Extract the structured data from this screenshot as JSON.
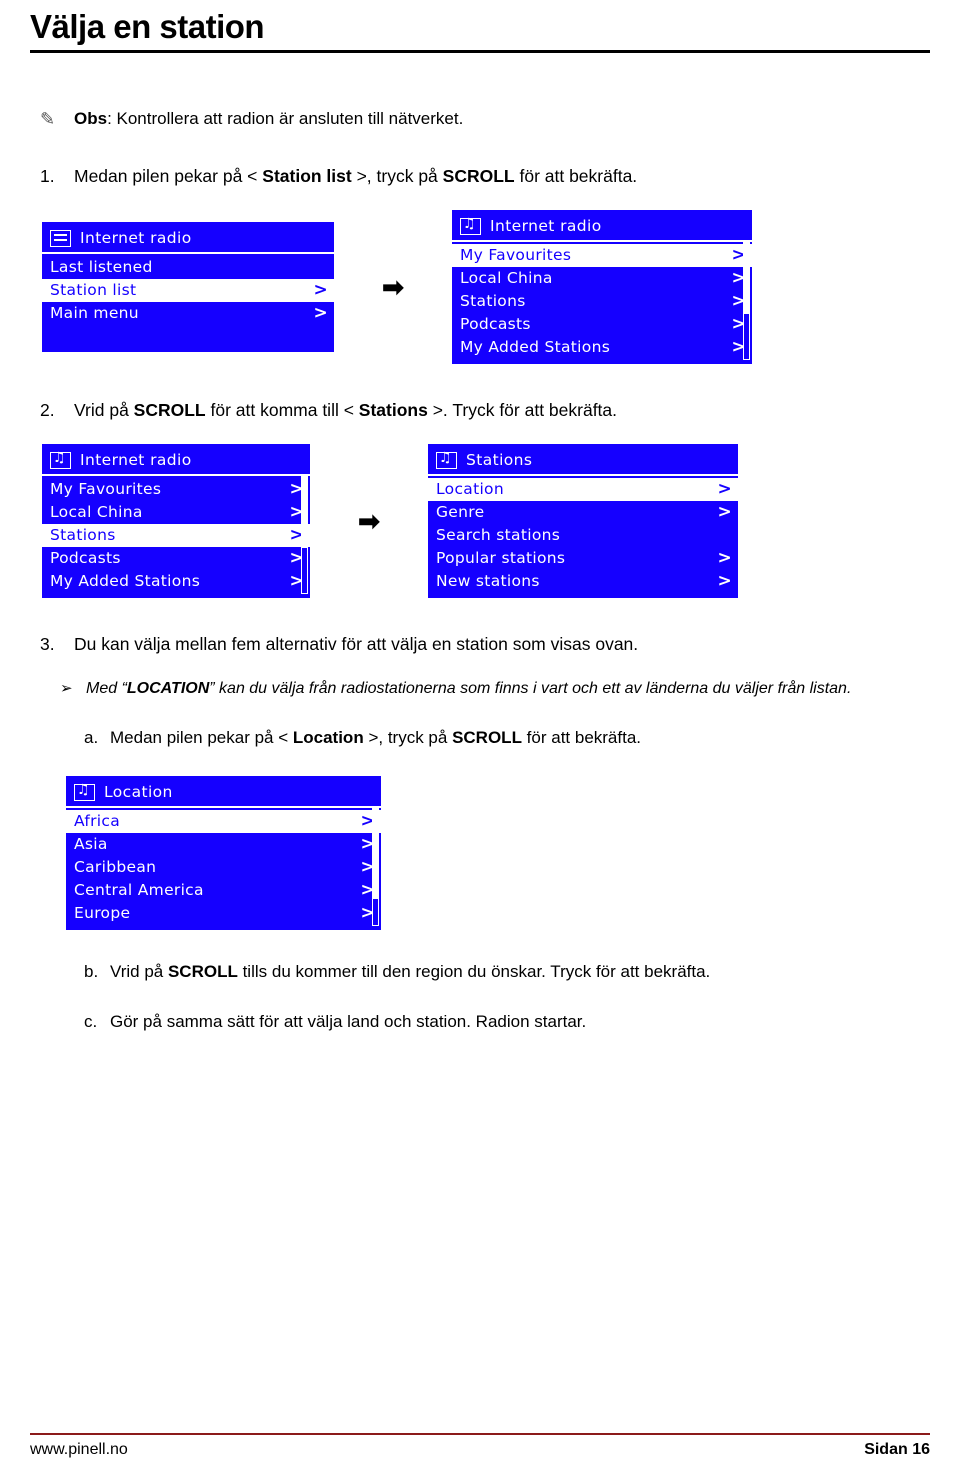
{
  "title": "Välja en station",
  "note": {
    "icon": "pen-note-icon",
    "prefix": "Obs",
    "text": ": Kontrollera att radion är ansluten till nätverket."
  },
  "steps": [
    {
      "num": "1.",
      "segments": [
        {
          "t": "Medan pilen pekar på < ",
          "b": false
        },
        {
          "t": "Station list",
          "b": true
        },
        {
          "t": " >, tryck på ",
          "b": false
        },
        {
          "t": "SCROLL",
          "b": true
        },
        {
          "t": " för att bekräfta.",
          "b": false
        }
      ]
    },
    {
      "num": "2.",
      "segments": [
        {
          "t": "Vrid på ",
          "b": false
        },
        {
          "t": "SCROLL",
          "b": true
        },
        {
          "t": " för att komma till < ",
          "b": false
        },
        {
          "t": "Stations",
          "b": true
        },
        {
          "t": " >. Tryck för att bekräfta.",
          "b": false
        }
      ]
    },
    {
      "num": "3.",
      "segments": [
        {
          "t": "Du kan välja mellan fem alternativ för att välja en station som visas ovan.",
          "b": false
        }
      ]
    }
  ],
  "bullet": {
    "mark": "➢",
    "segments": [
      {
        "t": "Med “",
        "b": false
      },
      {
        "t": "LOCATION",
        "b": true
      },
      {
        "t": "” kan du välja från radiostationerna som finns i vart och ett av länderna du väljer från listan.",
        "b": false
      }
    ]
  },
  "substeps": [
    {
      "letter": "a.",
      "segments": [
        {
          "t": "Medan pilen pekar på < ",
          "b": false
        },
        {
          "t": "Location",
          "b": true
        },
        {
          "t": " >, tryck på ",
          "b": false
        },
        {
          "t": "SCROLL",
          "b": true
        },
        {
          "t": " för att bekräfta.",
          "b": false
        }
      ]
    },
    {
      "letter": "b.",
      "segments": [
        {
          "t": "Vrid på ",
          "b": false
        },
        {
          "t": "SCROLL",
          "b": true
        },
        {
          "t": " tills du kommer till den region du önskar. Tryck för att bekräfta.",
          "b": false
        }
      ]
    },
    {
      "letter": "c.",
      "segments": [
        {
          "t": "Gör på samma sätt för att välja land och station. Radion startar.",
          "b": false
        }
      ]
    }
  ],
  "screens": {
    "s1": {
      "icon": "list-icon",
      "header": "Internet radio",
      "items": [
        {
          "label": "Last listened",
          "chev": "",
          "selected": false
        },
        {
          "label": "Station list",
          "chev": ">",
          "selected": true
        },
        {
          "label": "Main menu",
          "chev": ">",
          "selected": false
        }
      ]
    },
    "s2": {
      "icon": "music-note-icon",
      "header": "Internet radio",
      "items": [
        {
          "label": "My Favourites",
          "chev": ">",
          "selected": true
        },
        {
          "label": "Local China",
          "chev": ">",
          "selected": false
        },
        {
          "label": "Stations",
          "chev": ">",
          "selected": false
        },
        {
          "label": "Podcasts",
          "chev": ">",
          "selected": false
        },
        {
          "label": "My Added Stations",
          "chev": ">",
          "selected": false
        }
      ]
    },
    "s3": {
      "icon": "music-note-icon",
      "header": "Internet radio",
      "items": [
        {
          "label": "My Favourites",
          "chev": ">",
          "selected": false
        },
        {
          "label": "Local China",
          "chev": ">",
          "selected": false
        },
        {
          "label": "Stations",
          "chev": ">",
          "selected": true
        },
        {
          "label": "Podcasts",
          "chev": ">",
          "selected": false
        },
        {
          "label": "My Added Stations",
          "chev": ">",
          "selected": false
        }
      ]
    },
    "s4": {
      "icon": "music-note-icon",
      "header": "Stations",
      "items": [
        {
          "label": "Location",
          "chev": ">",
          "selected": true
        },
        {
          "label": "Genre",
          "chev": ">",
          "selected": false
        },
        {
          "label": "Search stations",
          "chev": "",
          "selected": false
        },
        {
          "label": "Popular stations",
          "chev": ">",
          "selected": false
        },
        {
          "label": "New stations",
          "chev": ">",
          "selected": false
        }
      ]
    },
    "s5": {
      "icon": "music-note-icon",
      "header": "Location",
      "items": [
        {
          "label": "Africa",
          "chev": ">",
          "selected": true
        },
        {
          "label": "Asia",
          "chev": ">",
          "selected": false
        },
        {
          "label": "Caribbean",
          "chev": ">",
          "selected": false
        },
        {
          "label": "Central America",
          "chev": ">",
          "selected": false
        },
        {
          "label": "Europe",
          "chev": ">",
          "selected": false
        }
      ]
    }
  },
  "arrow": "➡",
  "footer": {
    "left": "www.pinell.no",
    "right": "Sidan 16"
  }
}
